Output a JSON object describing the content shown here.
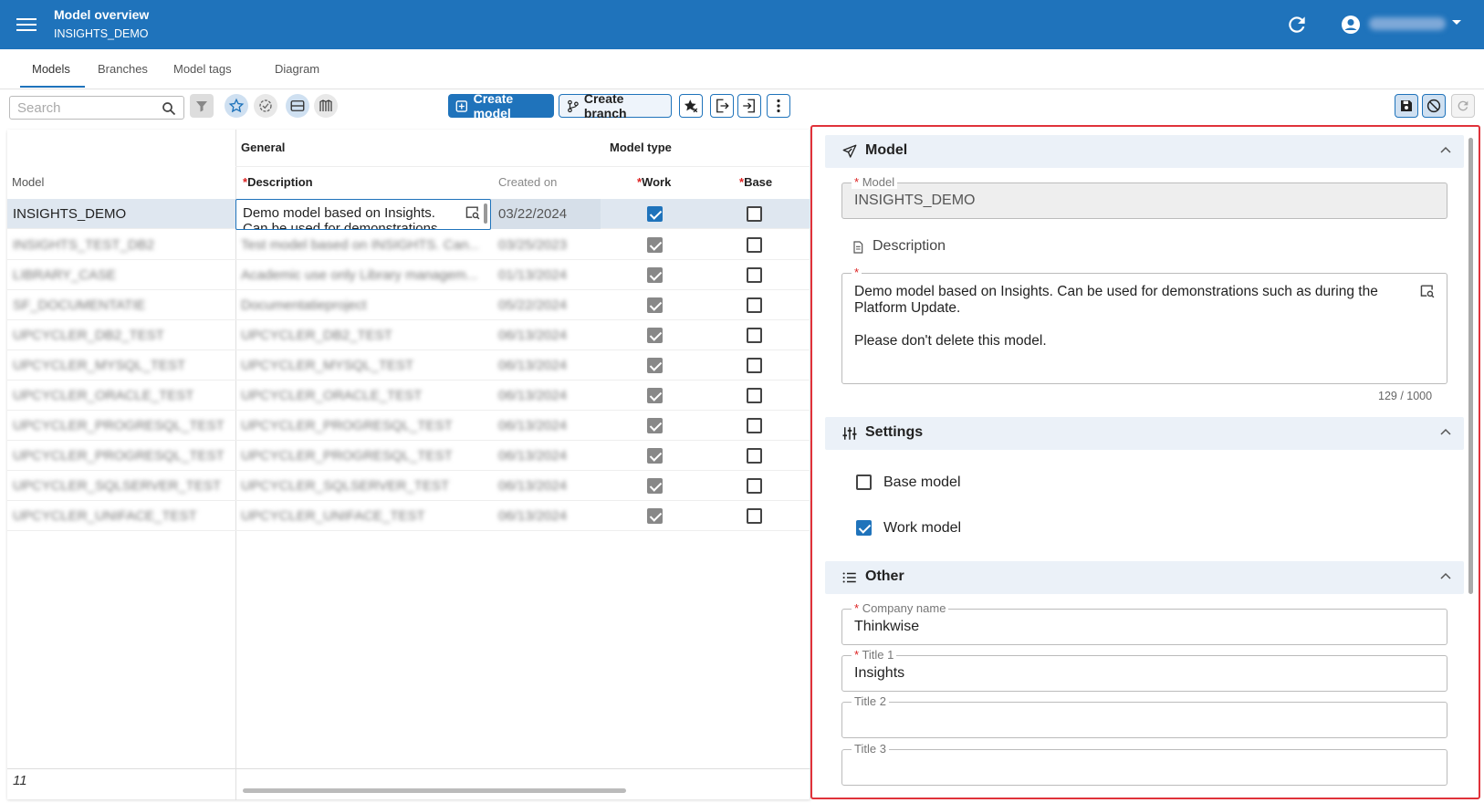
{
  "header": {
    "title": "Model overview",
    "subtitle": "INSIGHTS_DEMO",
    "menu_icon": "hamburger-icon",
    "refresh_icon": "refresh-icon",
    "user_icon": "account-circle-icon"
  },
  "tabs": [
    {
      "label": "Models",
      "active": true
    },
    {
      "label": "Branches"
    },
    {
      "label": "Model tags"
    },
    {
      "label": "Diagram"
    }
  ],
  "toolbar": {
    "search_placeholder": "Search",
    "create_model": "Create model",
    "create_branch": "Create branch"
  },
  "grid": {
    "group_general": "General",
    "group_model_type": "Model type",
    "col_model": "Model",
    "col_description": "Description",
    "col_created_on": "Created on",
    "col_work": "Work",
    "col_base": "Base",
    "selected_row": {
      "model": "INSIGHTS_DEMO",
      "description": "Demo model based on Insights. Can be used for demonstrations",
      "created_on": "03/22/2024",
      "work": true,
      "base": false
    },
    "rows": [
      {
        "model": "INSIGHTS_TEST_DB2",
        "description": "Test model based on INSIGHTS. Can...",
        "created_on": "03/25/2023",
        "work": true,
        "base": false
      },
      {
        "model": "LIBRARY_CASE",
        "description": "Academic use only Library managem...",
        "created_on": "01/13/2024",
        "work": true,
        "base": false
      },
      {
        "model": "SF_DOCUMENTATIE",
        "description": "Documentatieproject",
        "created_on": "05/22/2024",
        "work": true,
        "base": false
      },
      {
        "model": "UPCYCLER_DB2_TEST",
        "description": "UPCYCLER_DB2_TEST",
        "created_on": "06/13/2024",
        "work": true,
        "base": false
      },
      {
        "model": "UPCYCLER_MYSQL_TEST",
        "description": "UPCYCLER_MYSQL_TEST",
        "created_on": "06/13/2024",
        "work": true,
        "base": false
      },
      {
        "model": "UPCYCLER_ORACLE_TEST",
        "description": "UPCYCLER_ORACLE_TEST",
        "created_on": "06/13/2024",
        "work": true,
        "base": false
      },
      {
        "model": "UPCYCLER_PROGRESQL_TEST",
        "description": "UPCYCLER_PROGRESQL_TEST",
        "created_on": "06/13/2024",
        "work": true,
        "base": false
      },
      {
        "model": "UPCYCLER_PROGRESQL_TEST",
        "description": "UPCYCLER_PROGRESQL_TEST",
        "created_on": "06/13/2024",
        "work": true,
        "base": false
      },
      {
        "model": "UPCYCLER_SQLSERVER_TEST",
        "description": "UPCYCLER_SQLSERVER_TEST",
        "created_on": "06/13/2024",
        "work": true,
        "base": false
      },
      {
        "model": "UPCYCLER_UNIFACE_TEST",
        "description": "UPCYCLER_UNIFACE_TEST",
        "created_on": "06/13/2024",
        "work": true,
        "base": false
      }
    ],
    "row_count": "11"
  },
  "form": {
    "section_model": "Model",
    "model_label": "Model",
    "model_value": "INSIGHTS_DEMO",
    "description_title": "Description",
    "description_value_line1": "Demo model based on Insights. Can be used for demonstrations such as during the",
    "description_value_line2": "Platform Update.",
    "description_value_line3": "Please don't delete this model.",
    "char_count": "129 / 1000",
    "section_settings": "Settings",
    "base_model_label": "Base model",
    "base_model_checked": false,
    "work_model_label": "Work model",
    "work_model_checked": true,
    "section_other": "Other",
    "company_label": "Company name",
    "company_value": "Thinkwise",
    "title1_label": "Title 1",
    "title1_value": "Insights",
    "title2_label": "Title 2",
    "title2_value": "",
    "title3_label": "Title 3",
    "title3_value": ""
  },
  "colors": {
    "primary": "#1f73bb",
    "highlight_border": "#e0323a",
    "section_bg": "#ebf1f8"
  }
}
